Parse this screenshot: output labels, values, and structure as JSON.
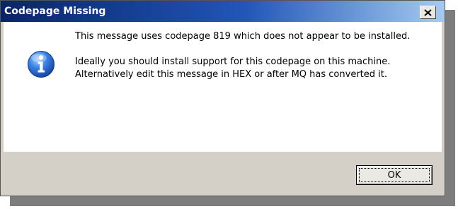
{
  "dialog": {
    "title": "Codepage Missing",
    "close_label": "X",
    "icon": "information-icon",
    "message_line1": "This message uses codepage 819 which does not appear to be installed.",
    "message_line2": "Ideally you should install support for this codepage on this machine. Alternatively edit this message in HEX or after MQ has converted it.",
    "ok_label": "OK"
  },
  "colors": {
    "title_gradient_start": "#0a246a",
    "title_gradient_end": "#a6caf0",
    "dialog_background": "#d4d0c8",
    "content_background": "#ffffff",
    "icon_blue": "#1f5fc4"
  }
}
